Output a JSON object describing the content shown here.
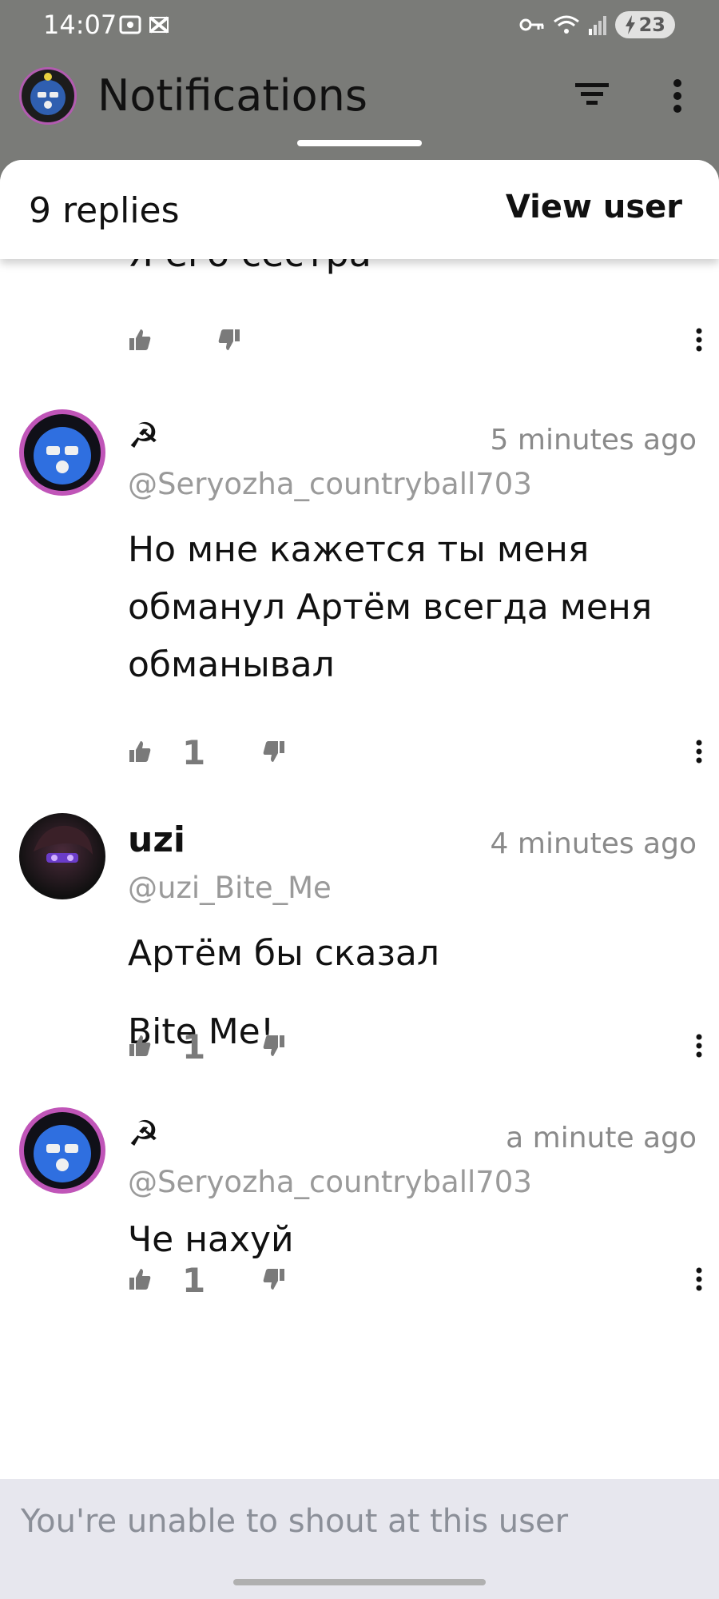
{
  "status_bar": {
    "time": "14:07",
    "battery": "23"
  },
  "app_bar": {
    "title": "Notifications"
  },
  "sheet": {
    "replies_count": "9 replies",
    "view_user_label": "View user",
    "partial_text": "Я его сестра"
  },
  "comments": [
    {
      "author": "☭",
      "time": "5 minutes ago",
      "handle": "@Seryozha_countryball703",
      "lines": [
        "Но мне кажется ты меня обманул Артём всегда меня обманывал"
      ],
      "likes": "1"
    },
    {
      "author": "uzi",
      "time": "4 minutes ago",
      "handle": "@uzi_Bite_Me",
      "lines": [
        "Артём бы сказал",
        "Bite Me!"
      ],
      "likes": "1"
    },
    {
      "author": "☭",
      "time": "a minute ago",
      "handle": "@Seryozha_countryball703",
      "lines": [
        "Че нахуй"
      ],
      "likes": "1"
    }
  ],
  "footer": {
    "notice": "You're unable to shout at this user"
  },
  "colors": {
    "backdrop": "#7a7b78",
    "avatar_ring": "#c055b8",
    "ball_blue": "#2f6fe0",
    "muted_text": "#8a8a8a",
    "footer_bg": "#e7e7ee"
  }
}
